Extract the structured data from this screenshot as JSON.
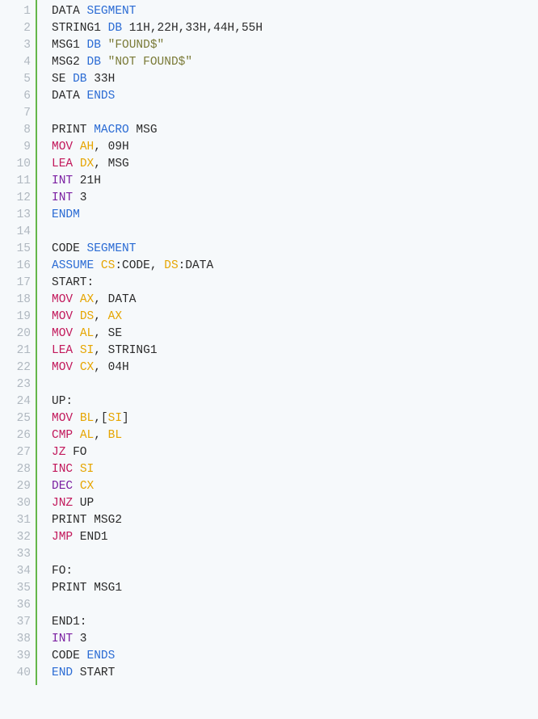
{
  "lines": [
    [
      {
        "t": "DATA ",
        "c": "tok-default"
      },
      {
        "t": "SEGMENT",
        "c": "tok-keyword"
      }
    ],
    [
      {
        "t": "STRING1 ",
        "c": "tok-default"
      },
      {
        "t": "DB",
        "c": "tok-keyword"
      },
      {
        "t": " 11H,22H,33H,44H,55H",
        "c": "tok-default"
      }
    ],
    [
      {
        "t": "MSG1 ",
        "c": "tok-default"
      },
      {
        "t": "DB",
        "c": "tok-keyword"
      },
      {
        "t": " ",
        "c": "tok-default"
      },
      {
        "t": "\"FOUND$\"",
        "c": "tok-string"
      }
    ],
    [
      {
        "t": "MSG2 ",
        "c": "tok-default"
      },
      {
        "t": "DB",
        "c": "tok-keyword"
      },
      {
        "t": " ",
        "c": "tok-default"
      },
      {
        "t": "\"NOT FOUND$\"",
        "c": "tok-string"
      }
    ],
    [
      {
        "t": "SE ",
        "c": "tok-default"
      },
      {
        "t": "DB",
        "c": "tok-keyword"
      },
      {
        "t": " 33H",
        "c": "tok-default"
      }
    ],
    [
      {
        "t": "DATA ",
        "c": "tok-default"
      },
      {
        "t": "ENDS",
        "c": "tok-keyword"
      }
    ],
    [],
    [
      {
        "t": "PRINT ",
        "c": "tok-default"
      },
      {
        "t": "MACRO",
        "c": "tok-keyword"
      },
      {
        "t": " MSG",
        "c": "tok-default"
      }
    ],
    [
      {
        "t": "MOV",
        "c": "tok-mnemonic"
      },
      {
        "t": " ",
        "c": "tok-default"
      },
      {
        "t": "AH",
        "c": "tok-reg"
      },
      {
        "t": ", 09H",
        "c": "tok-default"
      }
    ],
    [
      {
        "t": "LEA",
        "c": "tok-mnemonic"
      },
      {
        "t": " ",
        "c": "tok-default"
      },
      {
        "t": "DX",
        "c": "tok-reg"
      },
      {
        "t": ", MSG",
        "c": "tok-default"
      }
    ],
    [
      {
        "t": "INT",
        "c": "tok-int"
      },
      {
        "t": " 21H",
        "c": "tok-default"
      }
    ],
    [
      {
        "t": "INT",
        "c": "tok-int"
      },
      {
        "t": " 3",
        "c": "tok-default"
      }
    ],
    [
      {
        "t": "ENDM",
        "c": "tok-keyword"
      }
    ],
    [],
    [
      {
        "t": "CODE ",
        "c": "tok-default"
      },
      {
        "t": "SEGMENT",
        "c": "tok-keyword"
      }
    ],
    [
      {
        "t": "ASSUME",
        "c": "tok-keyword"
      },
      {
        "t": " ",
        "c": "tok-default"
      },
      {
        "t": "CS",
        "c": "tok-reg"
      },
      {
        "t": ":CODE, ",
        "c": "tok-default"
      },
      {
        "t": "DS",
        "c": "tok-reg"
      },
      {
        "t": ":DATA",
        "c": "tok-default"
      }
    ],
    [
      {
        "t": "START:",
        "c": "tok-default"
      }
    ],
    [
      {
        "t": "MOV",
        "c": "tok-mnemonic"
      },
      {
        "t": " ",
        "c": "tok-default"
      },
      {
        "t": "AX",
        "c": "tok-reg"
      },
      {
        "t": ", DATA",
        "c": "tok-default"
      }
    ],
    [
      {
        "t": "MOV",
        "c": "tok-mnemonic"
      },
      {
        "t": " ",
        "c": "tok-default"
      },
      {
        "t": "DS",
        "c": "tok-reg"
      },
      {
        "t": ", ",
        "c": "tok-default"
      },
      {
        "t": "AX",
        "c": "tok-reg"
      }
    ],
    [
      {
        "t": "MOV",
        "c": "tok-mnemonic"
      },
      {
        "t": " ",
        "c": "tok-default"
      },
      {
        "t": "AL",
        "c": "tok-reg"
      },
      {
        "t": ", SE",
        "c": "tok-default"
      }
    ],
    [
      {
        "t": "LEA",
        "c": "tok-mnemonic"
      },
      {
        "t": " ",
        "c": "tok-default"
      },
      {
        "t": "SI",
        "c": "tok-reg"
      },
      {
        "t": ", STRING1",
        "c": "tok-default"
      }
    ],
    [
      {
        "t": "MOV",
        "c": "tok-mnemonic"
      },
      {
        "t": " ",
        "c": "tok-default"
      },
      {
        "t": "CX",
        "c": "tok-reg"
      },
      {
        "t": ", 04H",
        "c": "tok-default"
      }
    ],
    [],
    [
      {
        "t": "UP:",
        "c": "tok-default"
      }
    ],
    [
      {
        "t": "MOV",
        "c": "tok-mnemonic"
      },
      {
        "t": " ",
        "c": "tok-default"
      },
      {
        "t": "BL",
        "c": "tok-reg"
      },
      {
        "t": ",[",
        "c": "tok-default"
      },
      {
        "t": "SI",
        "c": "tok-reg"
      },
      {
        "t": "]",
        "c": "tok-default"
      }
    ],
    [
      {
        "t": "CMP",
        "c": "tok-mnemonic"
      },
      {
        "t": " ",
        "c": "tok-default"
      },
      {
        "t": "AL",
        "c": "tok-reg"
      },
      {
        "t": ", ",
        "c": "tok-default"
      },
      {
        "t": "BL",
        "c": "tok-reg"
      }
    ],
    [
      {
        "t": "JZ",
        "c": "tok-mnemonic"
      },
      {
        "t": " FO",
        "c": "tok-default"
      }
    ],
    [
      {
        "t": "INC",
        "c": "tok-mnemonic"
      },
      {
        "t": " ",
        "c": "tok-default"
      },
      {
        "t": "SI",
        "c": "tok-reg"
      }
    ],
    [
      {
        "t": "DEC",
        "c": "tok-int"
      },
      {
        "t": " ",
        "c": "tok-default"
      },
      {
        "t": "CX",
        "c": "tok-reg"
      }
    ],
    [
      {
        "t": "JNZ",
        "c": "tok-mnemonic"
      },
      {
        "t": " UP",
        "c": "tok-default"
      }
    ],
    [
      {
        "t": "PRINT MSG2",
        "c": "tok-default"
      }
    ],
    [
      {
        "t": "JMP",
        "c": "tok-mnemonic"
      },
      {
        "t": " END1",
        "c": "tok-default"
      }
    ],
    [],
    [
      {
        "t": "FO:",
        "c": "tok-default"
      }
    ],
    [
      {
        "t": "PRINT MSG1",
        "c": "tok-default"
      }
    ],
    [],
    [
      {
        "t": "END1:",
        "c": "tok-default"
      }
    ],
    [
      {
        "t": "INT",
        "c": "tok-int"
      },
      {
        "t": " 3",
        "c": "tok-default"
      }
    ],
    [
      {
        "t": "CODE ",
        "c": "tok-default"
      },
      {
        "t": "ENDS",
        "c": "tok-keyword"
      }
    ],
    [
      {
        "t": "END",
        "c": "tok-keyword"
      },
      {
        "t": " START",
        "c": "tok-default"
      }
    ]
  ]
}
